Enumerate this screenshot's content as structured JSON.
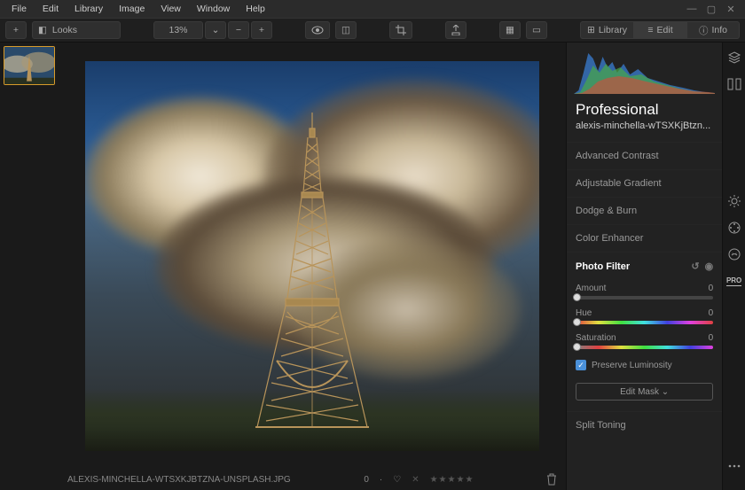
{
  "menu": {
    "items": [
      "File",
      "Edit",
      "Library",
      "Image",
      "View",
      "Window",
      "Help"
    ]
  },
  "toolbar": {
    "looks": "Looks",
    "zoom": "13%",
    "navs": [
      {
        "label": "Library",
        "icon": "library"
      },
      {
        "label": "Edit",
        "icon": "sliders"
      },
      {
        "label": "Info",
        "icon": "info"
      }
    ]
  },
  "footer": {
    "filename": "ALEXIS-MINCHELLA-WTSXKJBTZNA-UNSPLASH.JPG",
    "count": "0"
  },
  "panel": {
    "title": "Professional",
    "filename": "alexis-minchella-wTSXKjBtzn...",
    "items": [
      "Advanced Contrast",
      "Adjustable Gradient",
      "Dodge & Burn",
      "Color Enhancer"
    ],
    "active": "Photo Filter",
    "after": [
      "Split Toning"
    ],
    "sliders": {
      "amount": {
        "label": "Amount",
        "value": "0"
      },
      "hue": {
        "label": "Hue",
        "value": "0"
      },
      "sat": {
        "label": "Saturation",
        "value": "0"
      }
    },
    "preserve": "Preserve Luminosity",
    "mask": "Edit Mask ⌄"
  },
  "rail": {
    "pro": "PRO"
  }
}
